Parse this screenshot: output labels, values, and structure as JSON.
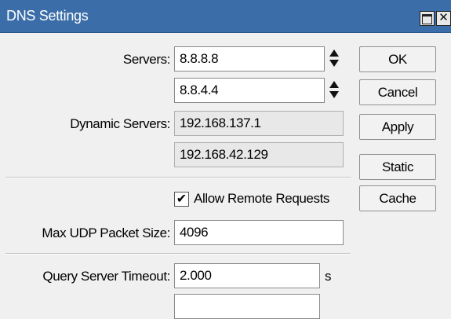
{
  "window": {
    "title": "DNS Settings",
    "title_bg": "#3b6ea8"
  },
  "titlebar_buttons": {
    "maximize_icon": "maximize-icon",
    "close_glyph": "✕"
  },
  "servers": {
    "label": "Servers:",
    "values": [
      "8.8.8.8",
      "8.8.4.4"
    ]
  },
  "dynamic_servers": {
    "label": "Dynamic Servers:",
    "values": [
      "192.168.137.1",
      "192.168.42.129"
    ]
  },
  "allow_remote": {
    "label": "Allow Remote Requests",
    "checked": true,
    "mark": "✔"
  },
  "max_udp": {
    "label": "Max UDP Packet Size:",
    "value": "4096"
  },
  "query_timeout": {
    "label": "Query Server Timeout:",
    "value": "2.000",
    "unit": "s"
  },
  "buttons": {
    "ok": "OK",
    "cancel": "Cancel",
    "apply": "Apply",
    "static": "Static",
    "cache": "Cache"
  }
}
